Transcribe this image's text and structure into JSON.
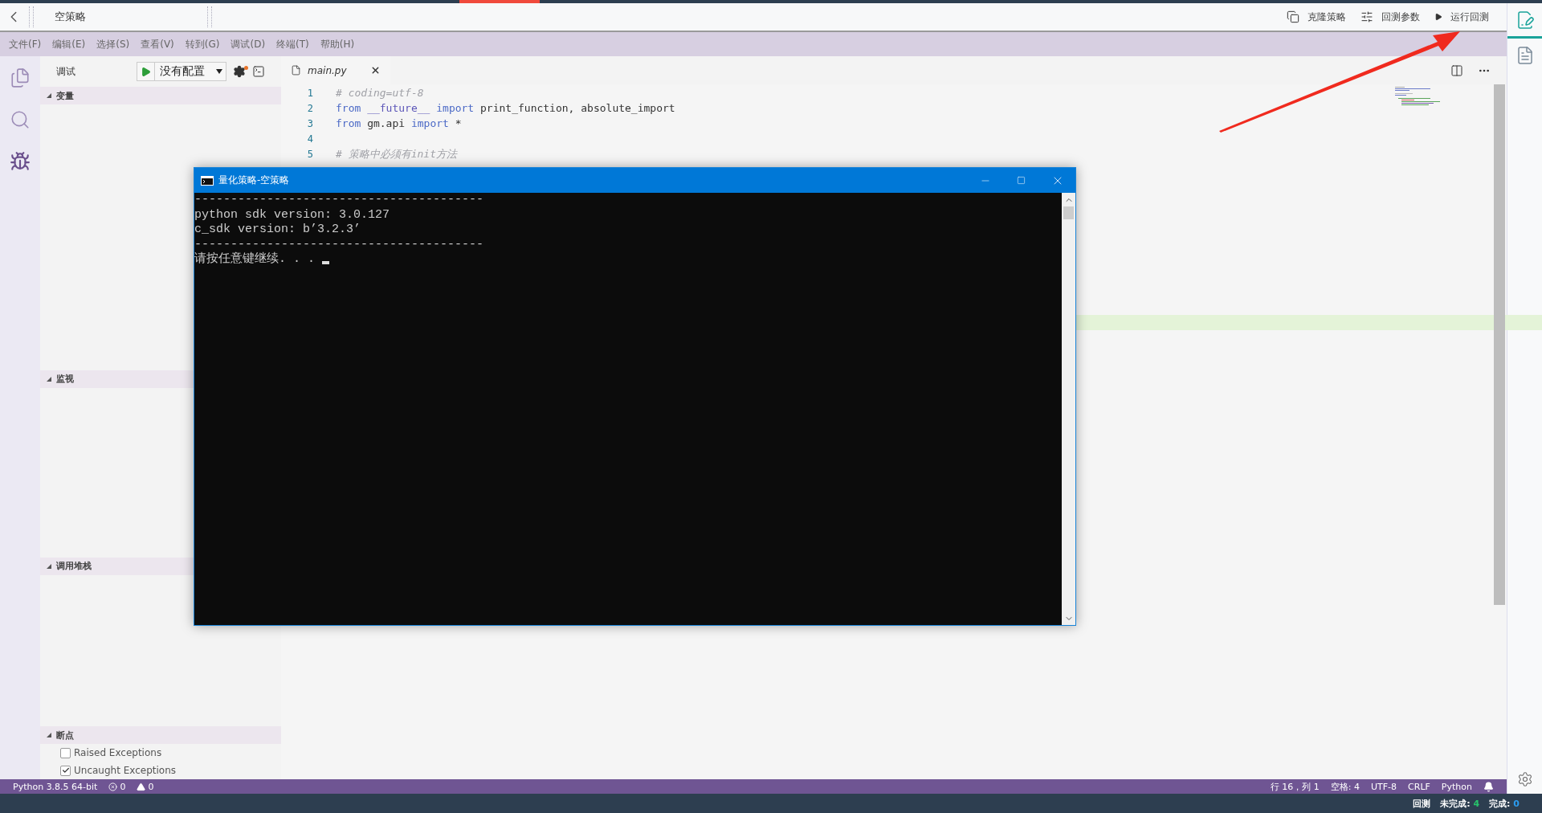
{
  "top_bar": {
    "title": "空策略",
    "actions": [
      {
        "kind": "copy",
        "label": "克隆策略"
      },
      {
        "kind": "sliders",
        "label": "回测参数"
      },
      {
        "kind": "play",
        "label": "运行回测"
      }
    ]
  },
  "menu": [
    "文件(F)",
    "编辑(E)",
    "选择(S)",
    "查看(V)",
    "转到(G)",
    "调试(D)",
    "终端(T)",
    "帮助(H)"
  ],
  "activity_bar": [
    {
      "kind": "files",
      "selected": false
    },
    {
      "kind": "search",
      "selected": false
    },
    {
      "kind": "debug",
      "selected": true
    }
  ],
  "debug_toolbar": {
    "label": "调试",
    "config": "没有配置"
  },
  "sidebar": {
    "sections": [
      {
        "title": "变量",
        "expanded": true
      },
      {
        "title": "监视",
        "expanded": true
      },
      {
        "title": "调用堆栈",
        "expanded": true
      },
      {
        "title": "断点",
        "expanded": true,
        "items": [
          {
            "label": "Raised Exceptions",
            "checked": false
          },
          {
            "label": "Uncaught Exceptions",
            "checked": true
          }
        ]
      }
    ]
  },
  "editor": {
    "tab": {
      "label": "main.py"
    },
    "lines": [
      {
        "number": "1",
        "tokens": [
          {
            "kind": "comment",
            "text": "# coding=utf-8"
          }
        ]
      },
      {
        "number": "2",
        "tokens": [
          {
            "kind": "keyword",
            "text": "from"
          },
          {
            "kind": "module",
            "text": " __future__"
          },
          {
            "kind": "keyword",
            "text": " import"
          },
          {
            "kind": "plain",
            "text": " print_function, absolute_import"
          }
        ]
      },
      {
        "number": "3",
        "tokens": [
          {
            "kind": "keyword",
            "text": "from"
          },
          {
            "kind": "plain",
            "text": " gm.api "
          },
          {
            "kind": "keyword",
            "text": "import"
          },
          {
            "kind": "plain",
            "text": " *"
          }
        ]
      },
      {
        "number": "4"
      },
      {
        "number": "5",
        "tokens": [
          {
            "kind": "comment",
            "text": "# 策略中必须有init方法"
          }
        ]
      }
    ]
  },
  "console": {
    "title": "量化策略-空策略",
    "lines": [
      "----------------------------------------",
      "python sdk version: 3.0.127",
      "c_sdk version: b’3.2.3’",
      "----------------------------------------",
      "请按任意键继续. . . "
    ]
  },
  "status_bar": {
    "interpreter": "Python 3.8.5 64-bit",
    "errors": "0",
    "warnings": "0",
    "right": [
      "行 16，列 1",
      "空格: 4",
      "UTF-8",
      "CRLF",
      "Python"
    ]
  },
  "right_panel": [
    {
      "kind": "edit",
      "selected": true
    },
    {
      "kind": "records",
      "selected": false
    }
  ],
  "bottom_bar": {
    "label": "回测",
    "counts": [
      {
        "label": "未完成:",
        "value": "4",
        "color": "#27c46b"
      },
      {
        "label": "完成:",
        "value": "0",
        "color": "#2b9cf0"
      }
    ]
  }
}
